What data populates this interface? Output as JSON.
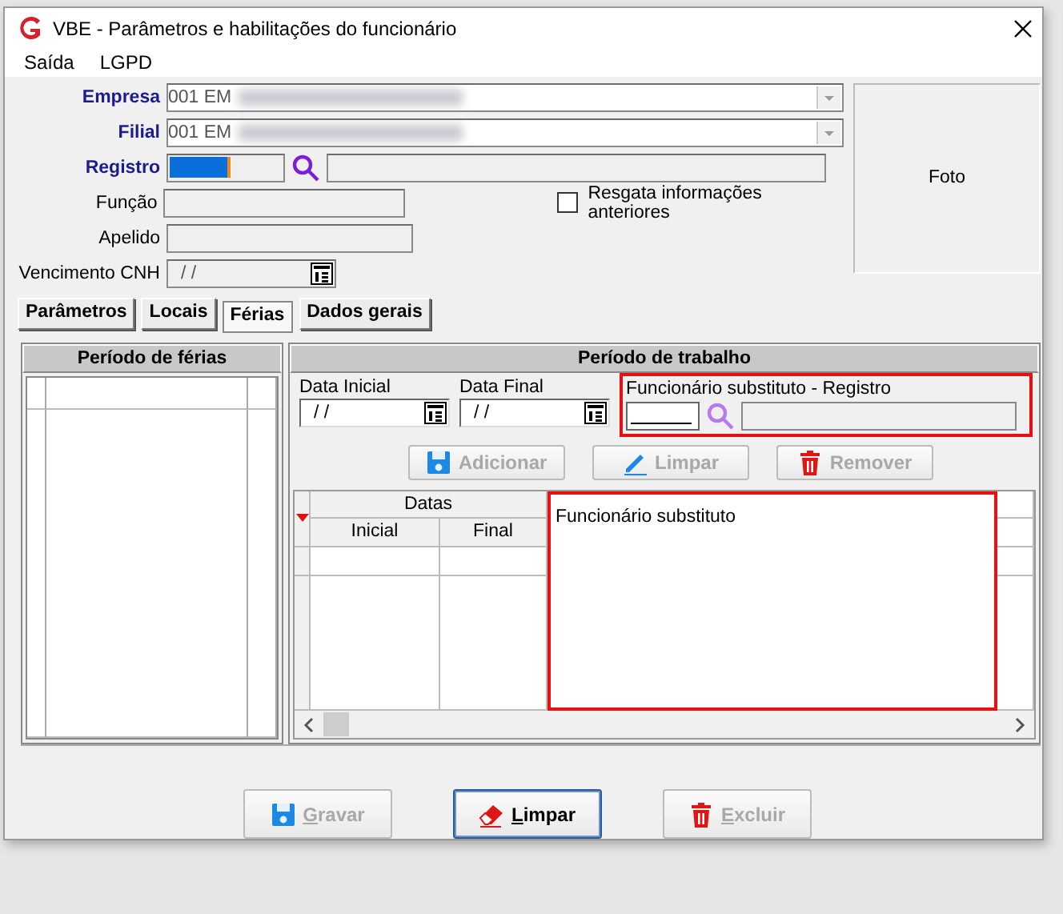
{
  "window": {
    "title": "VBE - Parâmetros e habilitações do funcionário"
  },
  "menu": [
    "Saída",
    "LGPD"
  ],
  "fields": [
    {
      "label": "Empresa",
      "kind": "combo",
      "emphasis": true,
      "value": "001 EM",
      "redacted": true
    },
    {
      "label": "Filial",
      "kind": "combo",
      "emphasis": true,
      "value": "001 EM",
      "redacted": true
    },
    {
      "label": "Registro",
      "kind": "lookup",
      "emphasis": true,
      "value_selected": true
    },
    {
      "label": "Função",
      "kind": "text",
      "emphasis": false
    },
    {
      "label": "Apelido",
      "kind": "text",
      "emphasis": false
    },
    {
      "label": "Vencimento  CNH",
      "kind": "date",
      "emphasis": false,
      "value": "/ /"
    }
  ],
  "checkbox": {
    "label": "Resgata informações anteriores",
    "checked": false
  },
  "photo": {
    "label": "Foto"
  },
  "tabs": [
    {
      "label": "Parâmetros",
      "selected": false
    },
    {
      "label": "Locais",
      "selected": false
    },
    {
      "label": "Férias",
      "selected": true
    },
    {
      "label": "Dados gerais",
      "selected": false
    }
  ],
  "vacation_panel": {
    "title": "Período de férias"
  },
  "work_panel": {
    "title": "Período de trabalho",
    "start_date": {
      "label": "Data Inicial",
      "value": "/ /"
    },
    "end_date": {
      "label": "Data Final",
      "value": "/ /"
    },
    "substitute": {
      "label": "Funcionário substituto - Registro",
      "highlighted": true
    },
    "buttons": [
      {
        "label": "Adicionar",
        "kind": "save",
        "disabled": true
      },
      {
        "label": "Limpar",
        "kind": "pencil",
        "disabled": true
      },
      {
        "label": "Remover",
        "kind": "trash",
        "disabled": true
      }
    ],
    "table": {
      "group_header": "Datas",
      "columns": [
        "Inicial",
        "Final"
      ],
      "substitute_column": {
        "label": "Funcionário substituto",
        "highlighted": true
      }
    }
  },
  "footer_buttons": [
    {
      "label": "Gravar",
      "kind": "save",
      "disabled": true,
      "focused": false
    },
    {
      "label": "Limpar",
      "kind": "eraser",
      "disabled": false,
      "focused": true
    },
    {
      "label": "Excluir",
      "kind": "trash",
      "disabled": true,
      "focused": false
    }
  ]
}
